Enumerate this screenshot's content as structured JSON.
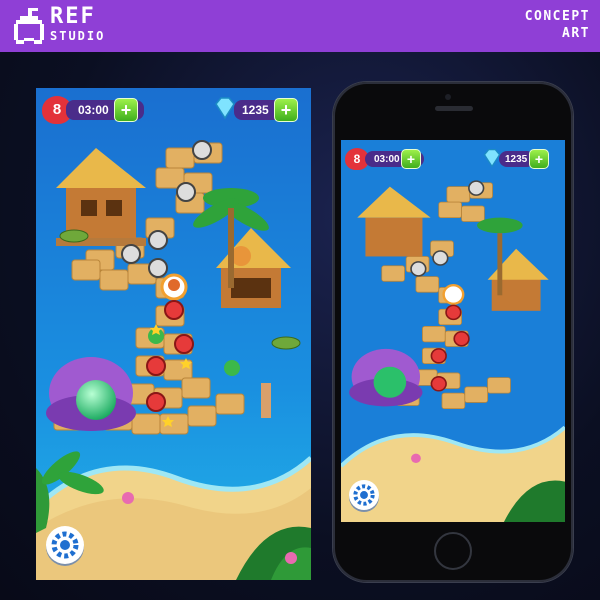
{
  "header": {
    "brand_title": "REF",
    "brand_subtitle": "STUDIO",
    "concept_line1": "CONCEPT",
    "concept_line2": "ART",
    "accent_color": "#8f3fd6"
  },
  "game": {
    "lives": "8",
    "timer": "03:00",
    "gems": "1235",
    "plus_label": "+",
    "icons": [
      "heart-icon",
      "gem-icon",
      "plus-icon",
      "settings-gear-icon",
      "stone-button-icon",
      "red-level-node-icon",
      "avatar-marker-icon",
      "star-icon"
    ]
  }
}
